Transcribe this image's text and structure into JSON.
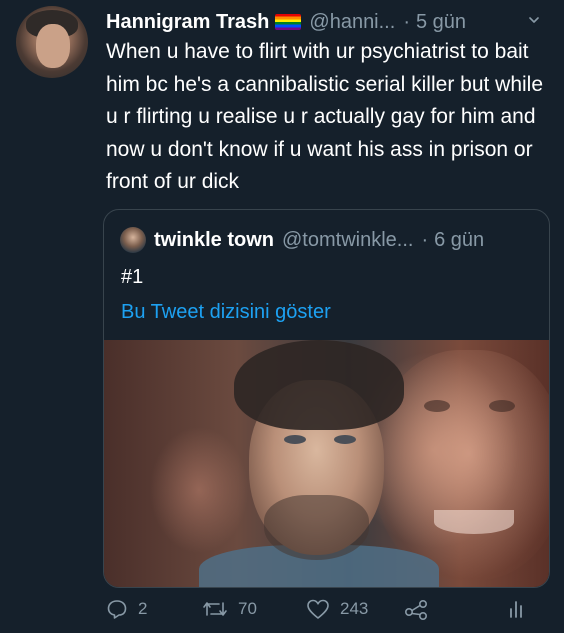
{
  "tweet": {
    "author_name": "Hannigram Trash",
    "handle": "@hanni...",
    "separator": "·",
    "time": "5 gün",
    "text": "When u have to flirt with ur psychiatrist to bait him bc he's a cannibalistic serial killer but while u r flirting u realise u r actually gay for him and now u don't know if u want his ass in prison or front of ur dick",
    "flag_icon": "rainbow-flag-icon",
    "menu_icon": "chevron-down-icon"
  },
  "quote": {
    "author_name": "twinkle town",
    "handle": "@tomtwinkle...",
    "separator": "·",
    "time": "6 gün",
    "text": "#1",
    "thread_link": "Bu Tweet dizisini göster"
  },
  "actions": {
    "replies": "2",
    "retweets": "70",
    "likes": "243"
  },
  "colors": {
    "background": "#15202b",
    "text_primary": "#ffffff",
    "text_secondary": "#8899a6",
    "link": "#1da1f2",
    "border": "#38444d"
  }
}
